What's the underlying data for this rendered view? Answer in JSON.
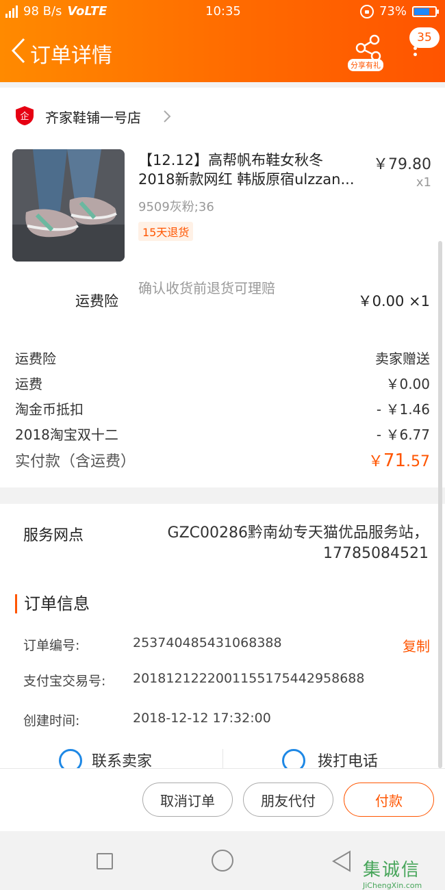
{
  "status": {
    "speed": "98 B/s",
    "volte": "VoLTE",
    "time": "10:35",
    "battery_pct": "73%",
    "battery_level": 0.73
  },
  "header": {
    "title": "订单详情",
    "share_label": "分享有礼",
    "badge": "35"
  },
  "shop": {
    "name": "齐家鞋铺一号店"
  },
  "item": {
    "name_line1": "【12.12】高帮帆布鞋女秋冬",
    "name_line2": "2018新款网红 韩版原宿ulzzan...",
    "price": "￥79.80",
    "qty": "x1",
    "sku": "9509灰粉;36",
    "tag": "15天退货"
  },
  "insurance": {
    "label": "运费险",
    "desc": "确认收货前退货可理赔",
    "value": "￥0.00 ×1"
  },
  "fees": [
    {
      "label": "运费险",
      "value": "卖家赠送"
    },
    {
      "label": "运费",
      "value": "￥0.00"
    },
    {
      "label": "淘金币抵扣",
      "value": "- ￥1.46"
    },
    {
      "label": "2018淘宝双十二",
      "value": "- ￥6.77"
    }
  ],
  "total": {
    "label": "实付款（含运费）",
    "currency": "￥",
    "integer": "71",
    "decimal": ".57"
  },
  "service": {
    "label": "服务网点",
    "value_line1": "GZC00286黔南幼专天猫优品服务站，",
    "value_line2": "17785084521"
  },
  "order_info": {
    "section_title": "订单信息",
    "rows": [
      {
        "label": "订单编号:",
        "value": "253740485431068388",
        "action": "复制"
      },
      {
        "label": "支付宝交易号:",
        "value": "2018121222001155175442958688"
      },
      {
        "label": "创建时间:",
        "value": "2018-12-12 17:32:00"
      }
    ],
    "contact_seller": "联系卖家",
    "call_phone": "拨打电话"
  },
  "actions": {
    "cancel": "取消订单",
    "friend_pay": "朋友代付",
    "pay": "付款"
  },
  "watermark": {
    "cn": "集诚信",
    "en": "JiChengXin.com"
  },
  "colors": {
    "accent": "#ff5500",
    "header_start": "#ff8a00",
    "header_end": "#ff5400"
  }
}
